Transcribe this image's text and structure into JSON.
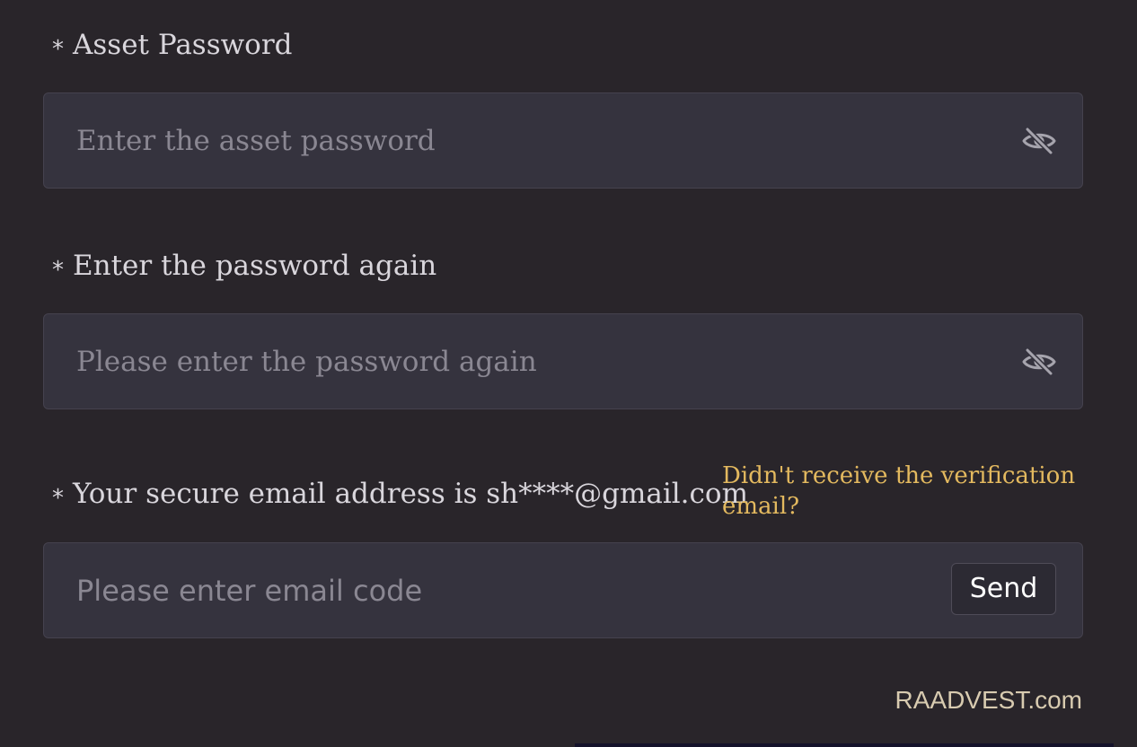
{
  "form": {
    "asset_password": {
      "required_mark": "*",
      "label": "Asset Password",
      "placeholder": "Enter the asset password",
      "value": "",
      "toggle_icon": "eye-slash-icon"
    },
    "confirm_password": {
      "required_mark": "*",
      "label": "Enter the password again",
      "placeholder": "Please enter the password again",
      "value": "",
      "toggle_icon": "eye-slash-icon"
    },
    "email_code": {
      "required_mark": "*",
      "label": "Your secure email address is sh****@gmail.com",
      "placeholder": "Please enter email code",
      "value": "",
      "resend_link": "Didn't receive the verification email?",
      "send_label": "Send"
    }
  },
  "watermark": "RAADVEST.com",
  "colors": {
    "background": "#29252a",
    "input_background": "#35333e",
    "link": "#e3b95f"
  }
}
